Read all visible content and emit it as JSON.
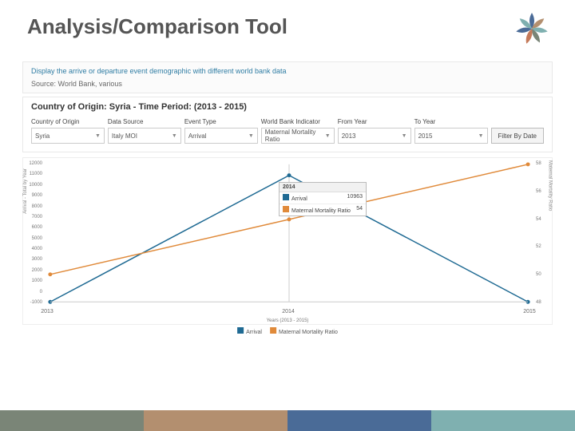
{
  "title": "Analysis/Comparison Tool",
  "description": "Display the arrive or departure event demographic with different world bank data",
  "source_label": "Source: World Bank, various",
  "subtitle": "Country of Origin: Syria - Time Period: (2013 - 2015)",
  "filters": {
    "country": {
      "label": "Country of Origin",
      "value": "Syria"
    },
    "datasource": {
      "label": "Data Source",
      "value": "Italy MOI"
    },
    "event": {
      "label": "Event Type",
      "value": "Arrival"
    },
    "indicator": {
      "label": "World Bank Indicator",
      "value": "Maternal Mortality Ratio"
    },
    "from": {
      "label": "From Year",
      "value": "2013"
    },
    "to": {
      "label": "To Year",
      "value": "2015"
    },
    "button": "Filter By Date"
  },
  "axis": {
    "ylabel_left": "Arrival - Total by Year",
    "ylabel_right": "Maternal Mortality Ratio",
    "xlabel": "Years (2013 - 2015)"
  },
  "legend": {
    "a": "Arrival",
    "b": "Maternal Mortality Ratio"
  },
  "tooltip": {
    "year": "2014",
    "a_label": "Arrival",
    "a_val": "10963",
    "b_label": "Maternal Mortality Ratio",
    "b_val": "54"
  },
  "colors": {
    "series_a": "#1f6a93",
    "series_b": "#e08a3a",
    "foot1": "#7a8577",
    "foot2": "#b38f6f",
    "foot3": "#4a6b97",
    "foot4": "#7fb0b0"
  },
  "chart_data": {
    "type": "line",
    "x": [
      2013,
      2014,
      2015
    ],
    "title": "Country of Origin: Syria - Time Period: (2013 - 2015)",
    "xlabel": "Years (2013 - 2015)",
    "series": [
      {
        "name": "Arrival",
        "axis": "left",
        "values": [
          -1000,
          10963,
          -1000
        ]
      },
      {
        "name": "Maternal Mortality Ratio",
        "axis": "right",
        "values": [
          50,
          54,
          58
        ]
      }
    ],
    "y_left": {
      "label": "Arrival - Total by Year",
      "min": -1000,
      "max": 12000,
      "ticks": [
        -1000,
        0,
        1000,
        2000,
        3000,
        4000,
        5000,
        6000,
        7000,
        8000,
        9000,
        10000,
        11000,
        12000
      ]
    },
    "y_right": {
      "label": "Maternal Mortality Ratio",
      "min": 48,
      "max": 58,
      "ticks": [
        48,
        50,
        52,
        54,
        56,
        58
      ]
    }
  }
}
